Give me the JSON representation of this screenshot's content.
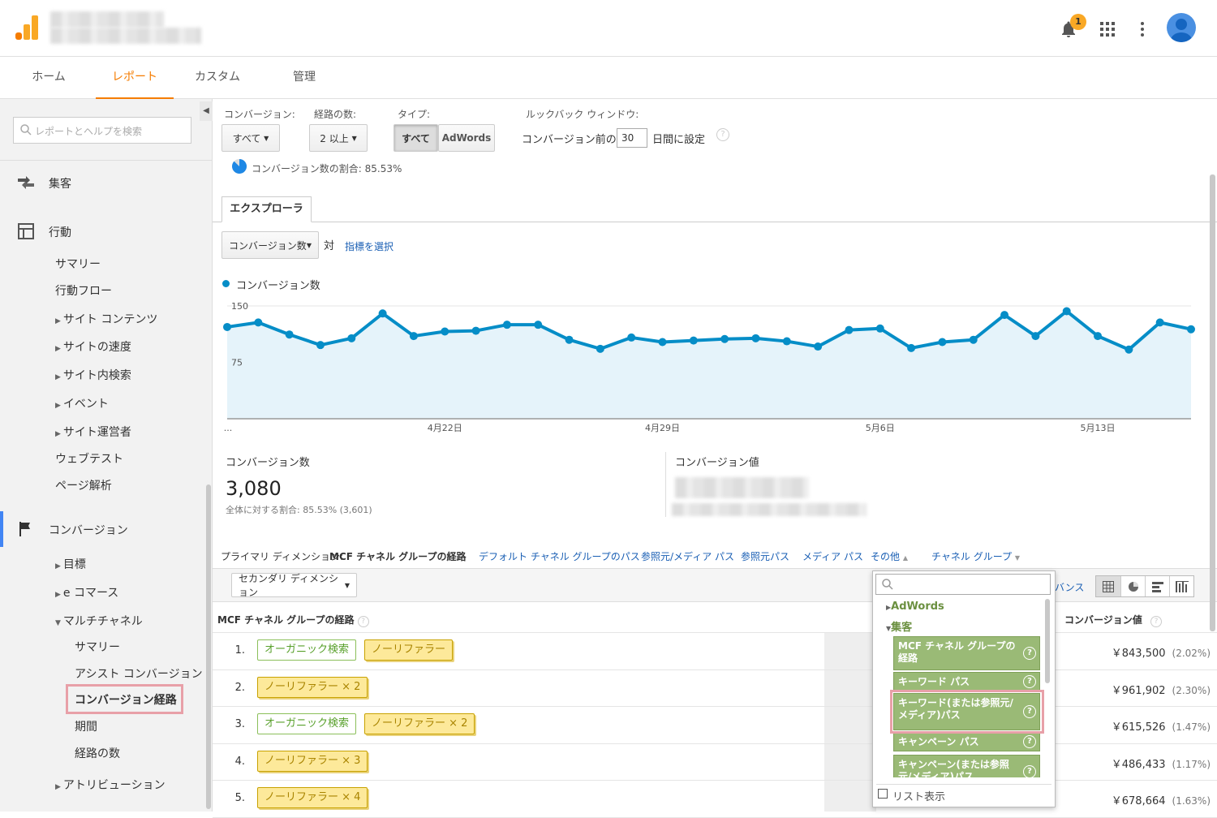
{
  "header": {
    "notification_count": "1"
  },
  "nav": {
    "tabs": [
      "ホーム",
      "レポート",
      "カスタム",
      "管理"
    ]
  },
  "sidebar": {
    "search_placeholder": "レポートとヘルプを検索",
    "items": [
      "集客",
      "行動",
      "サマリー",
      "行動フロー",
      "サイト コンテンツ",
      "サイトの速度",
      "サイト内検索",
      "イベント",
      "サイト運営者",
      "ウェブテスト",
      "ページ解析",
      "コンバージョン",
      "目標",
      "e コマース",
      "マルチチャネル",
      "サマリー",
      "アシスト コンバージョン",
      "コンバージョン経路",
      "期間",
      "経路の数",
      "アトリビューション"
    ]
  },
  "controls": {
    "conversion_label": "コンバージョン:",
    "conversion_value": "すべて",
    "paths_label": "経路の数:",
    "paths_value": "2 以上",
    "type_label": "タイプ:",
    "type_all": "すべて",
    "type_adwords": "AdWords",
    "lookback_label": "ルックバック ウィンドウ:",
    "lookback_prefix": "コンバージョン前の",
    "lookback_value": "30",
    "lookback_suffix": "日間に設定",
    "sampling_text": "コンバージョン数の割合: 85.53%"
  },
  "explorer": {
    "tab": "エクスプローラ",
    "metric": "コンバージョン数",
    "vs": "対",
    "select_metric": "指標を選択"
  },
  "chart_data": {
    "type": "area",
    "series": [
      {
        "name": "コンバージョン数",
        "values": [
          122,
          128,
          112,
          98,
          107,
          140,
          110,
          116,
          117,
          125,
          125,
          105,
          93,
          108,
          102,
          104,
          106,
          107,
          103,
          96,
          118,
          120,
          94,
          102,
          105,
          138,
          110,
          143,
          110,
          92,
          128,
          119
        ]
      }
    ],
    "x_ticks": [
      "...",
      "4月22日",
      "4月29日",
      "5月6日",
      "5月13日"
    ],
    "y_ticks": [
      "150",
      "75"
    ],
    "ylim": [
      0,
      150
    ],
    "color": "#058dc7",
    "fill": "#e5f3fa"
  },
  "scorecards": {
    "conv_label": "コンバージョン数",
    "conv_value": "3,080",
    "conv_sub": "全体に対する割合: 85.53% (3,601)",
    "value_label": "コンバージョン値"
  },
  "dimensions": {
    "primary_label": "プライマリ ディメンション:",
    "active": "MCF チャネル グループの経路",
    "links": [
      "デフォルト チャネル グループのパス",
      "参照元/メディア パス",
      "参照元パス",
      "メディア パス",
      "その他",
      "チャネル グループ"
    ],
    "secondary": "セカンダリ ディメンション",
    "partial_text": "バンス"
  },
  "table": {
    "col_path": "MCF チャネル グループの経路",
    "col_value": "コンバージョン値",
    "rows": [
      {
        "num": "1.",
        "steps": [
          "オーガニック検索",
          "ノーリファラー"
        ],
        "value": "￥843,500",
        "pct": "(2.02%)"
      },
      {
        "num": "2.",
        "steps": [
          "ノーリファラー × 2"
        ],
        "value": "￥961,902",
        "pct": "(2.30%)"
      },
      {
        "num": "3.",
        "steps": [
          "オーガニック検索",
          "ノーリファラー × 2"
        ],
        "value": "￥615,526",
        "pct": "(1.47%)"
      },
      {
        "num": "4.",
        "steps": [
          "ノーリファラー × 3"
        ],
        "value": "￥486,433",
        "pct": "(1.17%)"
      },
      {
        "num": "5.",
        "steps": [
          "ノーリファラー × 4"
        ],
        "value": "￥678,664",
        "pct": "(1.63%)"
      }
    ]
  },
  "dropdown": {
    "group_adwords": "AdWords",
    "group_acq": "集客",
    "items": [
      "MCF チャネル グループの経路",
      "キーワード パス",
      "キーワード(または参照元/メディア)パス",
      "キャンペーン パス",
      "キャンペーン(または参照元/メディア)パス"
    ],
    "list_view": "リスト表示"
  }
}
